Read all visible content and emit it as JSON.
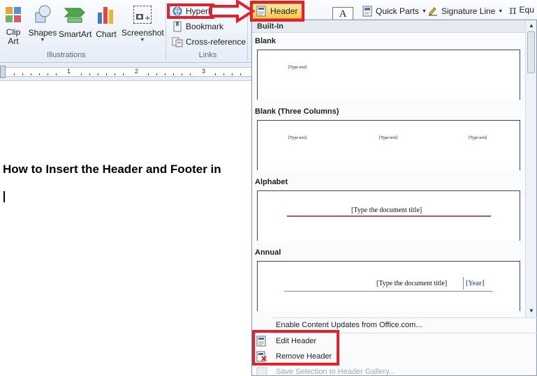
{
  "ribbon": {
    "illustrations": {
      "clip_art": "Clip\nArt",
      "clip_art_l1": "Clip",
      "clip_art_l2": "Art",
      "shapes": "Shapes",
      "smartart": "SmartArt",
      "chart": "Chart",
      "screenshot": "Screenshot",
      "group_label": "Illustrations"
    },
    "links": {
      "hyperlink": "Hyperlink",
      "bookmark": "Bookmark",
      "cross_reference": "Cross-reference",
      "group_label": "Links"
    },
    "header_button": "Header",
    "quick_parts": "Quick Parts",
    "signature_line": "Signature Line",
    "equation": "Equ"
  },
  "ruler": {
    "marks": [
      "1",
      "2",
      "3"
    ]
  },
  "document": {
    "heading": "How to Insert the Header and Footer in"
  },
  "gallery": {
    "section": "Built-In",
    "items": [
      {
        "name": "Blank",
        "texts": [
          "[Type text]"
        ]
      },
      {
        "name": "Blank (Three Columns)",
        "texts": [
          "[Type text]",
          "[Type text]",
          "[Type text]"
        ]
      },
      {
        "name": "Alphabet",
        "texts": [
          "[Type the document title]"
        ]
      },
      {
        "name": "Annual",
        "texts": [
          "[Type the document title]",
          "[Year]"
        ]
      }
    ],
    "menu": {
      "enable_updates": "Enable Content Updates from Office.com...",
      "edit_header": "Edit Header",
      "remove_header": "Remove Header",
      "save_selection": "Save Selection to Header Gallery..."
    }
  },
  "colors": {
    "annotation_red": "#e5202e",
    "alphabet_rule": "#c0392b",
    "annual_year": "#4f6fa6"
  }
}
